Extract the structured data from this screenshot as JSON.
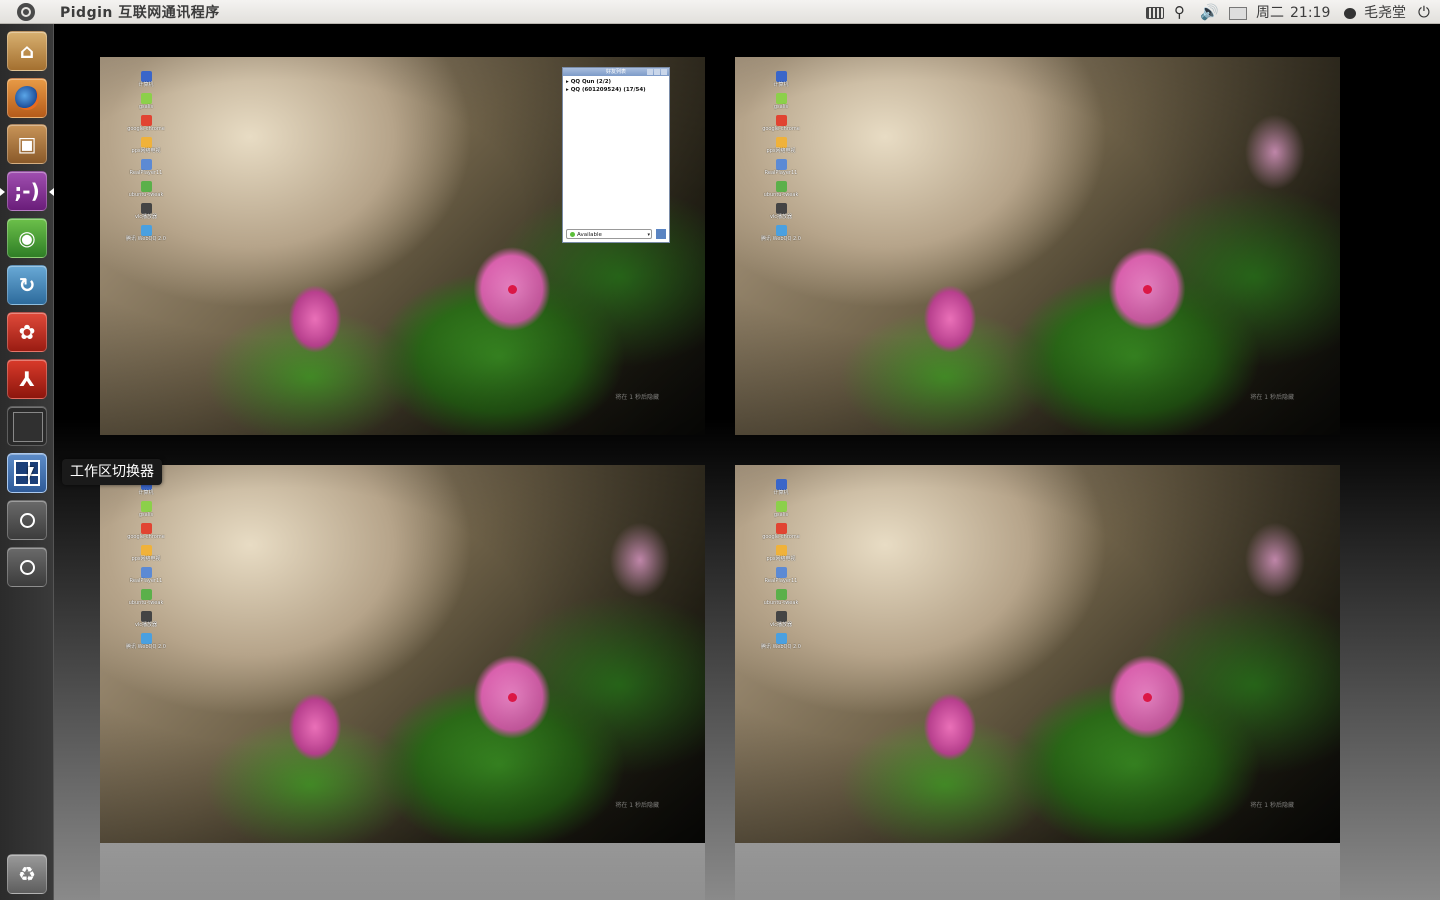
{
  "top_panel": {
    "app_title": "Pidgin 互联网通讯程序",
    "clock_date": "周二",
    "clock_time": "21:19",
    "user_name": "毛尧堂",
    "network_glyph": "⚲",
    "volume_glyph": "🔊",
    "power_glyph": "⏻"
  },
  "launcher": {
    "items": [
      {
        "name": "home-folder",
        "glyph": "⌂"
      },
      {
        "name": "firefox",
        "glyph": ""
      },
      {
        "name": "software-center",
        "glyph": "▣"
      },
      {
        "name": "pidgin",
        "glyph": ";-)"
      },
      {
        "name": "map-app",
        "glyph": "◉"
      },
      {
        "name": "sync-app",
        "glyph": "↻"
      },
      {
        "name": "red-app",
        "glyph": "✿"
      },
      {
        "name": "adobe-reader",
        "glyph": "⅄"
      },
      {
        "name": "terminal",
        "glyph": ">_"
      },
      {
        "name": "workspace-switcher",
        "glyph": ""
      },
      {
        "name": "zoom-in",
        "glyph": "+"
      },
      {
        "name": "zoom-other",
        "glyph": "◎"
      },
      {
        "name": "trash",
        "glyph": "♻"
      }
    ],
    "tooltip": "工作区切换器"
  },
  "desktop_icons": [
    {
      "label": "计算机",
      "color": "#3a66c9"
    },
    {
      "label": "gsalis",
      "color": "#8cd04a"
    },
    {
      "label": "google-chrome",
      "color": "#e14432"
    },
    {
      "label": "pps网络电视",
      "color": "#f0b23a"
    },
    {
      "label": "RealPlayer11",
      "color": "#5c8ad4"
    },
    {
      "label": "ubuntu-tweak",
      "color": "#5bb04a"
    },
    {
      "label": "vlc播放器",
      "color": "#444444"
    },
    {
      "label": "腾讯 WebQQ 2.0",
      "color": "#4aa0e0"
    }
  ],
  "workspace_label": "将在 1 秒后隐藏",
  "pidgin_window": {
    "title": "好友列表",
    "groups": [
      "QQ Qun (2/2)",
      "QQ (601209524) (17/54)"
    ],
    "status": "Available"
  }
}
